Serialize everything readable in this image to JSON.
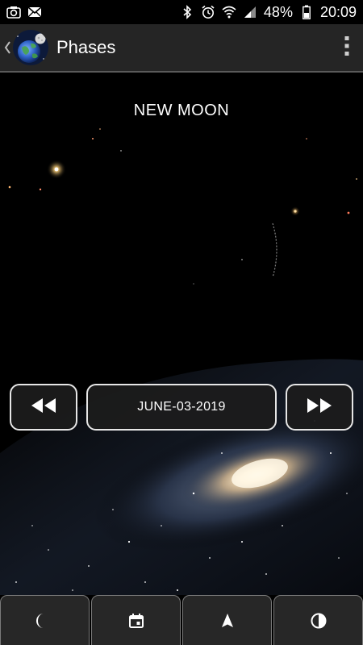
{
  "status_bar": {
    "left_icons": [
      "screenshot-icon",
      "email-icon"
    ],
    "right_icons": [
      "bluetooth-icon",
      "alarm-icon",
      "wifi-icon",
      "signal-icon"
    ],
    "battery": "48%",
    "time": "20:09"
  },
  "action_bar": {
    "title": "Phases",
    "up_icon": "chevron-left-icon",
    "app_icon": "earth-moon-app-icon",
    "overflow_icon": "overflow-menu-icon"
  },
  "main": {
    "phase_name": "NEW MOON",
    "date": "JUNE-03-2019",
    "prev_icon": "rewind-icon",
    "next_icon": "fast-forward-icon"
  },
  "tabs": [
    {
      "icon": "crescent-moon-icon"
    },
    {
      "icon": "calendar-icon"
    },
    {
      "icon": "navigation-arrow-icon"
    },
    {
      "icon": "half-contrast-icon"
    }
  ],
  "colors": {
    "status_bar": "#000000",
    "action_bar": "#252525",
    "button_border": "#e6e6e6",
    "button_fill": "#1c1c1c",
    "tab_fill": "#272727"
  }
}
